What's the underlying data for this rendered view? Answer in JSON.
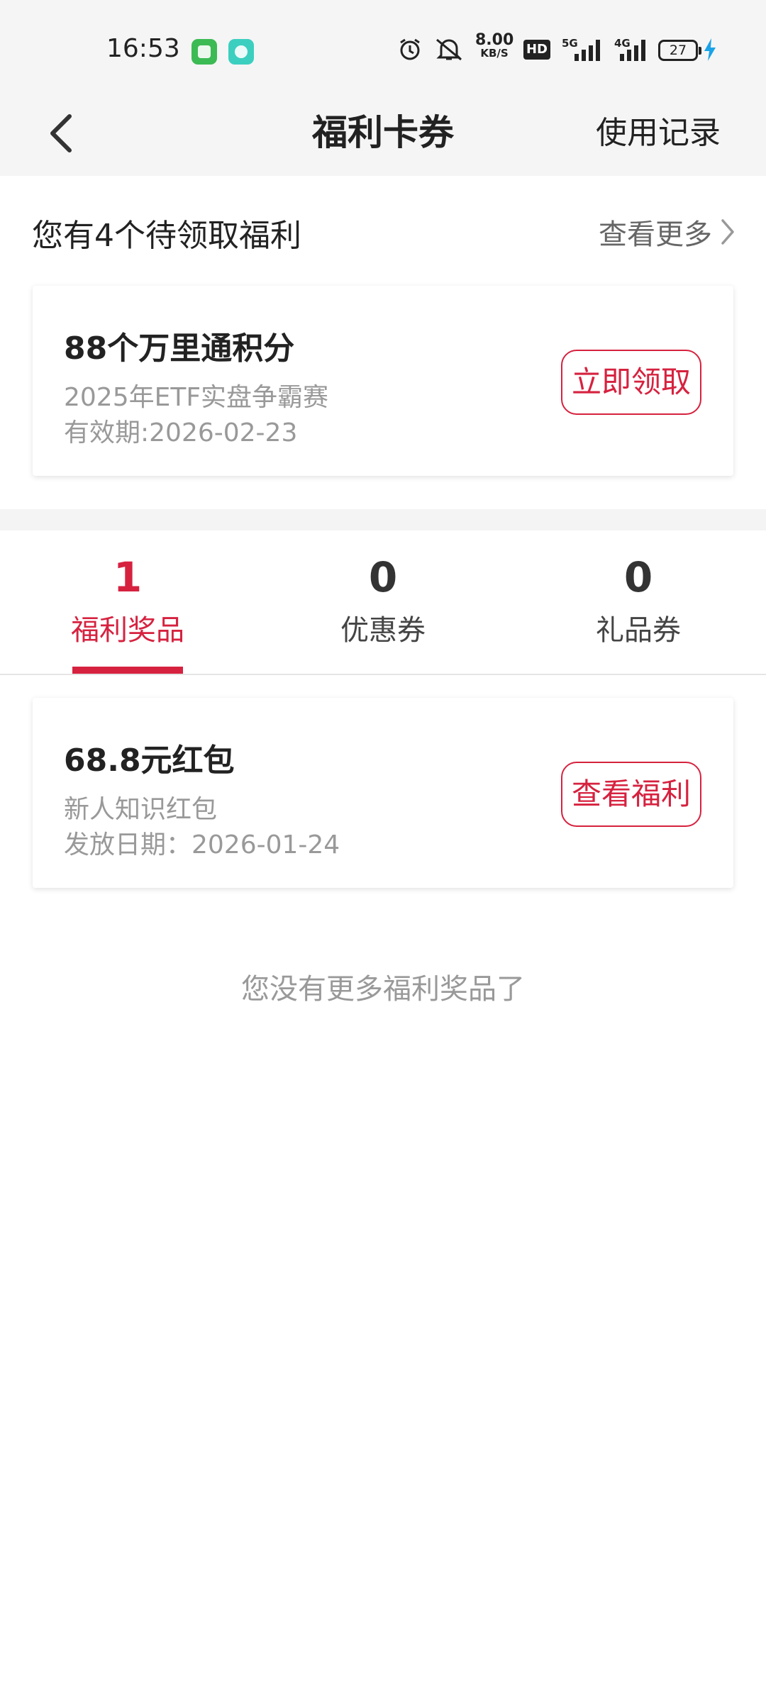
{
  "status_bar": {
    "time": "16:53",
    "net_speed_value": "8.00",
    "net_speed_unit": "KB/S",
    "hd_label": "HD",
    "sig1_label": "5G",
    "sig2_label": "4G",
    "battery": "27",
    "icons": [
      "message-app-icon",
      "music-app-icon",
      "alarm-icon",
      "mute-icon",
      "hd-icon",
      "signal-5g-icon",
      "signal-4g-icon",
      "battery-icon",
      "charging-icon"
    ]
  },
  "header": {
    "title": "福利卡券",
    "right_link": "使用记录"
  },
  "pending": {
    "text": "您有4个待领取福利",
    "more_label": "查看更多"
  },
  "pending_card": {
    "title": "88个万里通积分",
    "subtitle": "2025年ETF实盘争霸赛",
    "validity": "有效期:2026-02-23",
    "button": "立即领取"
  },
  "tabs": [
    {
      "count": "1",
      "label": "福利奖品",
      "active": true
    },
    {
      "count": "0",
      "label": "优惠券",
      "active": false
    },
    {
      "count": "0",
      "label": "礼品券",
      "active": false
    }
  ],
  "reward_card": {
    "title": "68.8元红包",
    "subtitle": "新人知识红包",
    "date": "发放日期：2026-01-24",
    "button": "查看福利"
  },
  "empty_note": "您没有更多福利奖品了",
  "colors": {
    "accent": "#d6223f",
    "text": "#222222",
    "muted": "#999999",
    "background_gray": "#f5f5f5"
  }
}
